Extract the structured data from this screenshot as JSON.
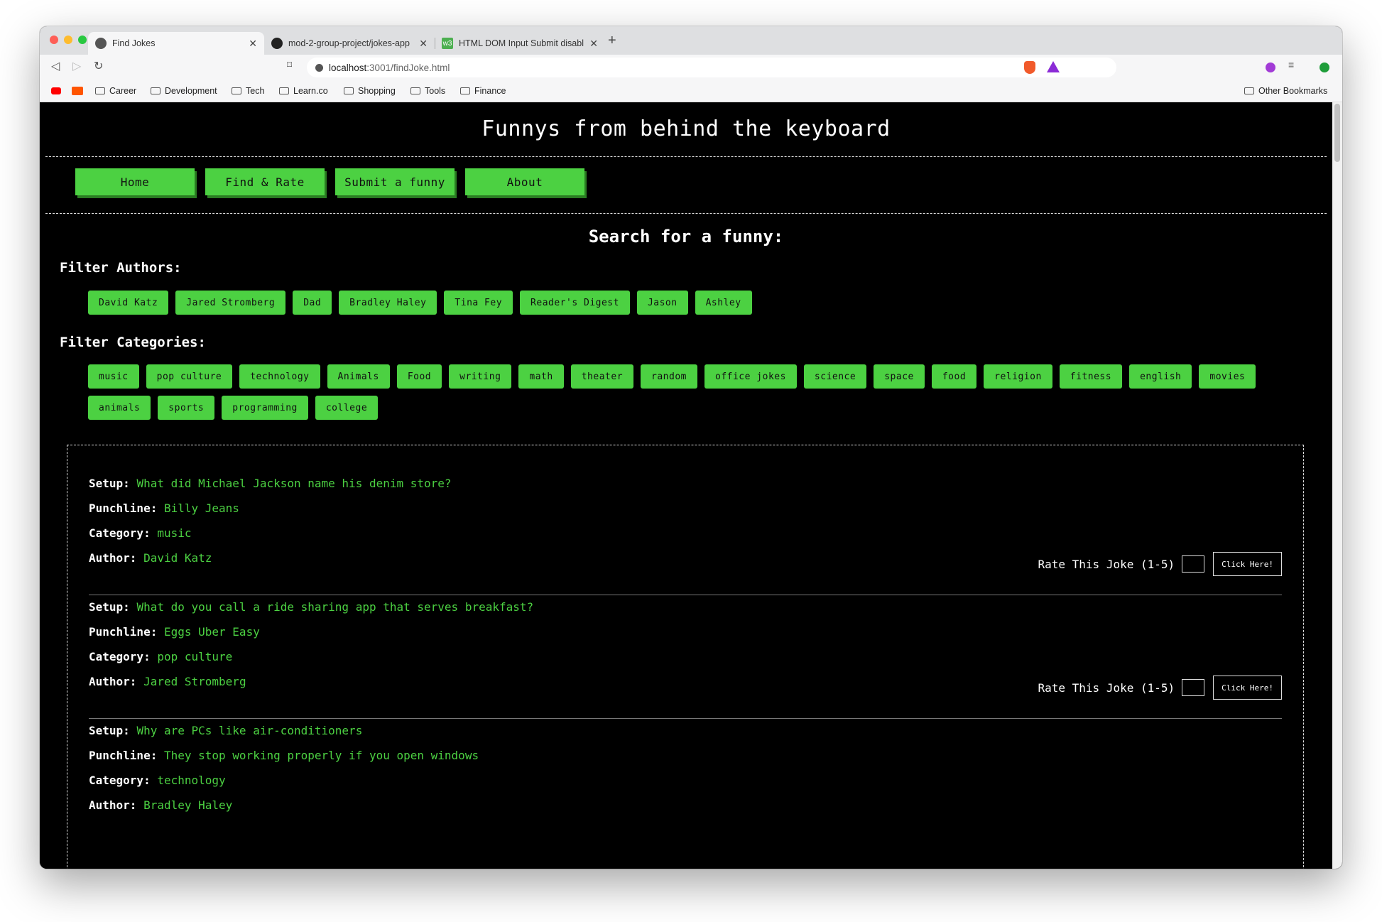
{
  "browser": {
    "tabs": [
      {
        "title": "Find Jokes",
        "favicon": "globe-icon"
      },
      {
        "title": "mod-2-group-project/jokes-app",
        "favicon": "github-icon"
      },
      {
        "title": "HTML DOM Input Submit disabl",
        "favicon": "w3-icon"
      }
    ],
    "url_host": "localhost",
    "url_path": ":3001/findJoke.html",
    "bookmarks": [
      "Career",
      "Development",
      "Tech",
      "Learn.co",
      "Shopping",
      "Tools",
      "Finance"
    ],
    "other_bookmarks": "Other Bookmarks"
  },
  "page": {
    "title": "Funnys from behind the keyboard",
    "nav": [
      "Home",
      "Find & Rate",
      "Submit a funny",
      "About"
    ],
    "search_heading": "Search for a funny:",
    "authors_heading": "Filter Authors:",
    "authors": [
      "David Katz",
      "Jared Stromberg",
      "Dad",
      "Bradley Haley",
      "Tina Fey",
      "Reader's Digest",
      "Jason",
      "Ashley"
    ],
    "categories_heading": "Filter Categories:",
    "categories": [
      "music",
      "pop culture",
      "technology",
      "Animals",
      "Food",
      "writing",
      "math",
      "theater",
      "random",
      "office jokes",
      "science",
      "space",
      "food",
      "religion",
      "fitness",
      "english",
      "movies",
      "animals",
      "sports",
      "programming",
      "college"
    ],
    "labels": {
      "setup": "Setup:",
      "punchline": "Punchline:",
      "category": "Category:",
      "author": "Author:"
    },
    "rate_label": "Rate This Joke (1-5)",
    "rate_button": "Click Here!",
    "jokes": [
      {
        "setup": "What did Michael Jackson name his denim store?",
        "punchline": "Billy Jeans",
        "category": "music",
        "author": "David Katz"
      },
      {
        "setup": "What do you call a ride sharing app that serves breakfast?",
        "punchline": "Eggs Uber Easy",
        "category": "pop culture",
        "author": "Jared Stromberg"
      },
      {
        "setup": "Why are PCs like air-conditioners",
        "punchline": "They stop working properly if you open windows",
        "category": "technology",
        "author": "Bradley Haley"
      }
    ]
  },
  "colors": {
    "accent": "#4cd142",
    "background": "#000000",
    "text": "#ffffff"
  }
}
